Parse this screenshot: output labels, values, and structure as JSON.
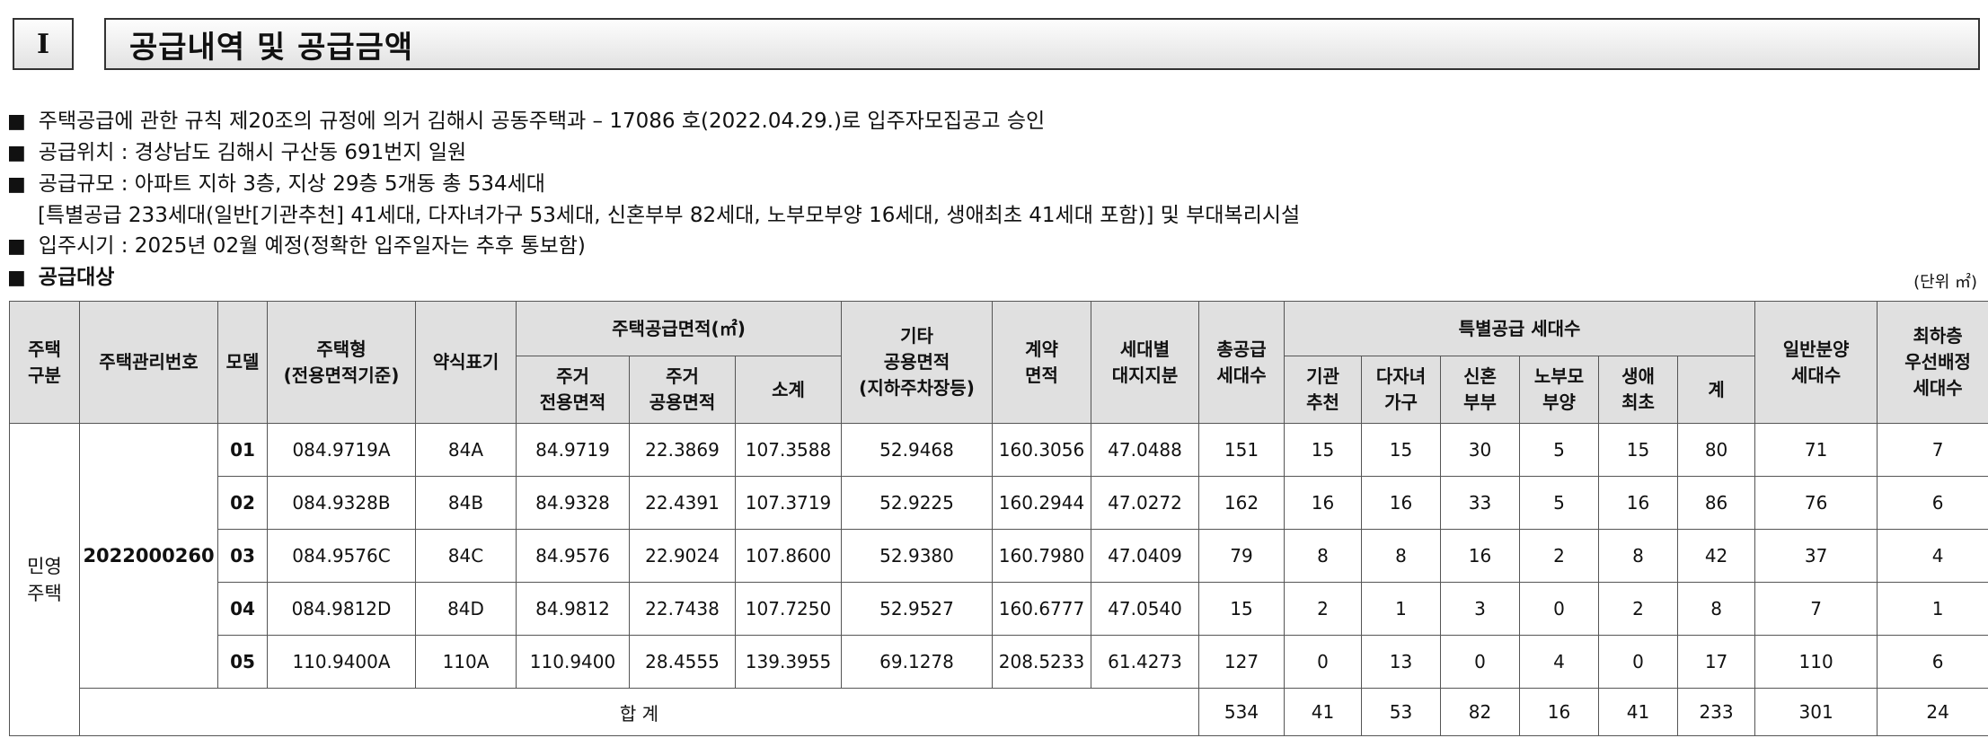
{
  "section": {
    "number": "I",
    "title": "공급내역 및 공급금액"
  },
  "notes": [
    "주택공급에 관한 규칙 제20조의 규정에 의거 김해시 공동주택과 – 17086 호(2022.04.29.)로 입주자모집공고 승인",
    "공급위치 : 경상남도 김해시 구산동 691번지 일원",
    "공급규모 : 아파트 지하 3층, 지상 29층 5개동 총 534세대",
    "[특별공급 233세대(일반[기관추천] 41세대, 다자녀가구 53세대, 신혼부부 82세대, 노부모부양 16세대, 생애최초 41세대 포함)] 및 부대복리시설",
    "입주시기 : 2025년 02월 예정(정확한 입주일자는 추후 통보함)",
    "공급대상"
  ],
  "bullet": "■",
  "unit_label": "(단위 ㎡)",
  "table": {
    "headers": {
      "housing_type": "주택\n구분",
      "mgmt_no": "주택관리번호",
      "model": "모델",
      "house_type": "주택형\n(전용면적기준)",
      "short": "약식표기",
      "supply_area": "주택공급면적(㎡)",
      "exclusive": "주거\n전용면적",
      "common": "주거\n공용면적",
      "subtotal": "소계",
      "other_common": "기타\n공용면적\n(지하주차장등)",
      "contract_area": "계약\n면적",
      "land_share": "세대별\n대지지분",
      "total_units": "총공급\n세대수",
      "special": "특별공급 세대수",
      "inst": "기관\n추천",
      "multi_child": "다자녀\n가구",
      "newlywed": "신혼\n부부",
      "elderly": "노부모\n부양",
      "first_time": "생애\n최초",
      "special_sum": "계",
      "general": "일반분양\n세대수",
      "lowest_floor": "최하층\n우선배정\n세대수"
    },
    "housing_type_value": "민영\n주택",
    "mgmt_no_value": "2022000260",
    "rows": [
      [
        "01",
        "084.9719A",
        "84A",
        "84.9719",
        "22.3869",
        "107.3588",
        "52.9468",
        "160.3056",
        "47.0488",
        "151",
        "15",
        "15",
        "30",
        "5",
        "15",
        "80",
        "71",
        "7"
      ],
      [
        "02",
        "084.9328B",
        "84B",
        "84.9328",
        "22.4391",
        "107.3719",
        "52.9225",
        "160.2944",
        "47.0272",
        "162",
        "16",
        "16",
        "33",
        "5",
        "16",
        "86",
        "76",
        "6"
      ],
      [
        "03",
        "084.9576C",
        "84C",
        "84.9576",
        "22.9024",
        "107.8600",
        "52.9380",
        "160.7980",
        "47.0409",
        "79",
        "8",
        "8",
        "16",
        "2",
        "8",
        "42",
        "37",
        "4"
      ],
      [
        "04",
        "084.9812D",
        "84D",
        "84.9812",
        "22.7438",
        "107.7250",
        "52.9527",
        "160.6777",
        "47.0540",
        "15",
        "2",
        "1",
        "3",
        "0",
        "2",
        "8",
        "7",
        "1"
      ],
      [
        "05",
        "110.9400A",
        "110A",
        "110.9400",
        "28.4555",
        "139.3955",
        "69.1278",
        "208.5233",
        "61.4273",
        "127",
        "0",
        "13",
        "0",
        "4",
        "0",
        "17",
        "110",
        "6"
      ]
    ],
    "total": {
      "label": "합 계",
      "values": [
        "534",
        "41",
        "53",
        "82",
        "16",
        "41",
        "233",
        "301",
        "24"
      ]
    }
  }
}
